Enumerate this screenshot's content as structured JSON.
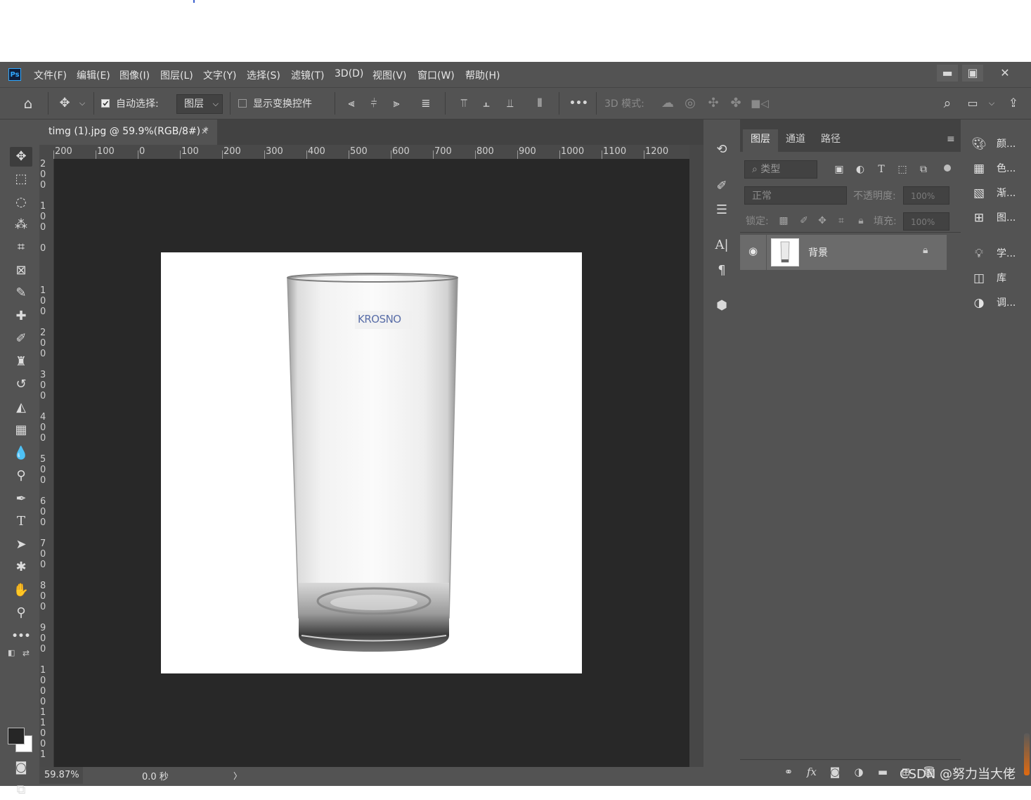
{
  "app": {
    "logo": "Ps"
  },
  "menu": [
    "文件(F)",
    "编辑(E)",
    "图像(I)",
    "图层(L)",
    "文字(Y)",
    "选择(S)",
    "滤镜(T)",
    "3D(D)",
    "视图(V)",
    "窗口(W)",
    "帮助(H)"
  ],
  "window_controls": {
    "minimize": "▬",
    "maximize": "▣",
    "close": "✕"
  },
  "options": {
    "auto_select_label": "自动选择:",
    "auto_select_target": "图层",
    "show_transform_label": "显示变换控件",
    "mode3d_label": "3D 模式:",
    "more": "•••"
  },
  "document": {
    "tab_title": "timg (1).jpg @ 59.9%(RGB/8#) *",
    "image_label": "KROSNO"
  },
  "ruler_h": [
    "200",
    "100",
    "0",
    "100",
    "200",
    "300",
    "400",
    "500",
    "600",
    "700",
    "800",
    "900",
    "1000",
    "1100",
    "1200"
  ],
  "ruler_v": [
    "200",
    "100",
    "0",
    "100",
    "200",
    "300",
    "400",
    "500",
    "600",
    "700",
    "800",
    "900",
    "1000",
    "1100",
    "1"
  ],
  "status": {
    "zoom": "59.87%",
    "time": "0.0 秒",
    "arrow": "〉"
  },
  "layers_panel": {
    "tabs": [
      "图层",
      "通道",
      "路径"
    ],
    "filter_kind": "类型",
    "blend_mode": "正常",
    "opacity_label": "不透明度:",
    "opacity_value": "100%",
    "lock_label": "锁定:",
    "fill_label": "填充:",
    "fill_value": "100%",
    "layers": [
      {
        "name": "背景",
        "visible": true,
        "locked": true
      }
    ]
  },
  "quick_panel": [
    "颜...",
    "色...",
    "渐...",
    "图...",
    "学...",
    "库",
    "调..."
  ],
  "watermark": "CSDN @努力当大佬",
  "colors": {
    "ui": "#535353",
    "canvas": "#282828",
    "panel_dark": "#424242",
    "accent": "#31a8ff"
  }
}
